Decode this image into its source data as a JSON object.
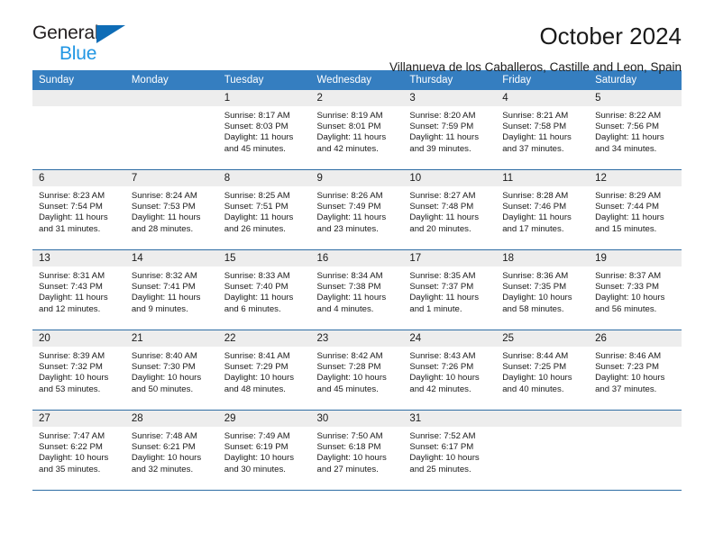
{
  "logo": {
    "word_one": "General",
    "word_two": "Blue",
    "triangle_icon": "blue-triangle-icon",
    "colors": {
      "general": "#231f20",
      "blue": "#2196e3",
      "triangle": "#0e6cb6"
    }
  },
  "header": {
    "title": "October 2024",
    "subtitle": "Villanueva de los Caballeros, Castille and Leon, Spain"
  },
  "theme": {
    "header_row_bg": "#357ec0",
    "day_number_bg": "#ededed",
    "week_divider": "#2e6da4",
    "text": "#1a1a1a"
  },
  "calendar": {
    "weekday_headers": [
      "Sunday",
      "Monday",
      "Tuesday",
      "Wednesday",
      "Thursday",
      "Friday",
      "Saturday"
    ],
    "weeks": [
      [
        {
          "day": "",
          "sunrise": "",
          "sunset": "",
          "daylight": ""
        },
        {
          "day": "",
          "sunrise": "",
          "sunset": "",
          "daylight": ""
        },
        {
          "day": "1",
          "sunrise": "Sunrise: 8:17 AM",
          "sunset": "Sunset: 8:03 PM",
          "daylight": "Daylight: 11 hours and 45 minutes."
        },
        {
          "day": "2",
          "sunrise": "Sunrise: 8:19 AM",
          "sunset": "Sunset: 8:01 PM",
          "daylight": "Daylight: 11 hours and 42 minutes."
        },
        {
          "day": "3",
          "sunrise": "Sunrise: 8:20 AM",
          "sunset": "Sunset: 7:59 PM",
          "daylight": "Daylight: 11 hours and 39 minutes."
        },
        {
          "day": "4",
          "sunrise": "Sunrise: 8:21 AM",
          "sunset": "Sunset: 7:58 PM",
          "daylight": "Daylight: 11 hours and 37 minutes."
        },
        {
          "day": "5",
          "sunrise": "Sunrise: 8:22 AM",
          "sunset": "Sunset: 7:56 PM",
          "daylight": "Daylight: 11 hours and 34 minutes."
        }
      ],
      [
        {
          "day": "6",
          "sunrise": "Sunrise: 8:23 AM",
          "sunset": "Sunset: 7:54 PM",
          "daylight": "Daylight: 11 hours and 31 minutes."
        },
        {
          "day": "7",
          "sunrise": "Sunrise: 8:24 AM",
          "sunset": "Sunset: 7:53 PM",
          "daylight": "Daylight: 11 hours and 28 minutes."
        },
        {
          "day": "8",
          "sunrise": "Sunrise: 8:25 AM",
          "sunset": "Sunset: 7:51 PM",
          "daylight": "Daylight: 11 hours and 26 minutes."
        },
        {
          "day": "9",
          "sunrise": "Sunrise: 8:26 AM",
          "sunset": "Sunset: 7:49 PM",
          "daylight": "Daylight: 11 hours and 23 minutes."
        },
        {
          "day": "10",
          "sunrise": "Sunrise: 8:27 AM",
          "sunset": "Sunset: 7:48 PM",
          "daylight": "Daylight: 11 hours and 20 minutes."
        },
        {
          "day": "11",
          "sunrise": "Sunrise: 8:28 AM",
          "sunset": "Sunset: 7:46 PM",
          "daylight": "Daylight: 11 hours and 17 minutes."
        },
        {
          "day": "12",
          "sunrise": "Sunrise: 8:29 AM",
          "sunset": "Sunset: 7:44 PM",
          "daylight": "Daylight: 11 hours and 15 minutes."
        }
      ],
      [
        {
          "day": "13",
          "sunrise": "Sunrise: 8:31 AM",
          "sunset": "Sunset: 7:43 PM",
          "daylight": "Daylight: 11 hours and 12 minutes."
        },
        {
          "day": "14",
          "sunrise": "Sunrise: 8:32 AM",
          "sunset": "Sunset: 7:41 PM",
          "daylight": "Daylight: 11 hours and 9 minutes."
        },
        {
          "day": "15",
          "sunrise": "Sunrise: 8:33 AM",
          "sunset": "Sunset: 7:40 PM",
          "daylight": "Daylight: 11 hours and 6 minutes."
        },
        {
          "day": "16",
          "sunrise": "Sunrise: 8:34 AM",
          "sunset": "Sunset: 7:38 PM",
          "daylight": "Daylight: 11 hours and 4 minutes."
        },
        {
          "day": "17",
          "sunrise": "Sunrise: 8:35 AM",
          "sunset": "Sunset: 7:37 PM",
          "daylight": "Daylight: 11 hours and 1 minute."
        },
        {
          "day": "18",
          "sunrise": "Sunrise: 8:36 AM",
          "sunset": "Sunset: 7:35 PM",
          "daylight": "Daylight: 10 hours and 58 minutes."
        },
        {
          "day": "19",
          "sunrise": "Sunrise: 8:37 AM",
          "sunset": "Sunset: 7:33 PM",
          "daylight": "Daylight: 10 hours and 56 minutes."
        }
      ],
      [
        {
          "day": "20",
          "sunrise": "Sunrise: 8:39 AM",
          "sunset": "Sunset: 7:32 PM",
          "daylight": "Daylight: 10 hours and 53 minutes."
        },
        {
          "day": "21",
          "sunrise": "Sunrise: 8:40 AM",
          "sunset": "Sunset: 7:30 PM",
          "daylight": "Daylight: 10 hours and 50 minutes."
        },
        {
          "day": "22",
          "sunrise": "Sunrise: 8:41 AM",
          "sunset": "Sunset: 7:29 PM",
          "daylight": "Daylight: 10 hours and 48 minutes."
        },
        {
          "day": "23",
          "sunrise": "Sunrise: 8:42 AM",
          "sunset": "Sunset: 7:28 PM",
          "daylight": "Daylight: 10 hours and 45 minutes."
        },
        {
          "day": "24",
          "sunrise": "Sunrise: 8:43 AM",
          "sunset": "Sunset: 7:26 PM",
          "daylight": "Daylight: 10 hours and 42 minutes."
        },
        {
          "day": "25",
          "sunrise": "Sunrise: 8:44 AM",
          "sunset": "Sunset: 7:25 PM",
          "daylight": "Daylight: 10 hours and 40 minutes."
        },
        {
          "day": "26",
          "sunrise": "Sunrise: 8:46 AM",
          "sunset": "Sunset: 7:23 PM",
          "daylight": "Daylight: 10 hours and 37 minutes."
        }
      ],
      [
        {
          "day": "27",
          "sunrise": "Sunrise: 7:47 AM",
          "sunset": "Sunset: 6:22 PM",
          "daylight": "Daylight: 10 hours and 35 minutes."
        },
        {
          "day": "28",
          "sunrise": "Sunrise: 7:48 AM",
          "sunset": "Sunset: 6:21 PM",
          "daylight": "Daylight: 10 hours and 32 minutes."
        },
        {
          "day": "29",
          "sunrise": "Sunrise: 7:49 AM",
          "sunset": "Sunset: 6:19 PM",
          "daylight": "Daylight: 10 hours and 30 minutes."
        },
        {
          "day": "30",
          "sunrise": "Sunrise: 7:50 AM",
          "sunset": "Sunset: 6:18 PM",
          "daylight": "Daylight: 10 hours and 27 minutes."
        },
        {
          "day": "31",
          "sunrise": "Sunrise: 7:52 AM",
          "sunset": "Sunset: 6:17 PM",
          "daylight": "Daylight: 10 hours and 25 minutes."
        },
        {
          "day": "",
          "sunrise": "",
          "sunset": "",
          "daylight": ""
        },
        {
          "day": "",
          "sunrise": "",
          "sunset": "",
          "daylight": ""
        }
      ]
    ]
  }
}
